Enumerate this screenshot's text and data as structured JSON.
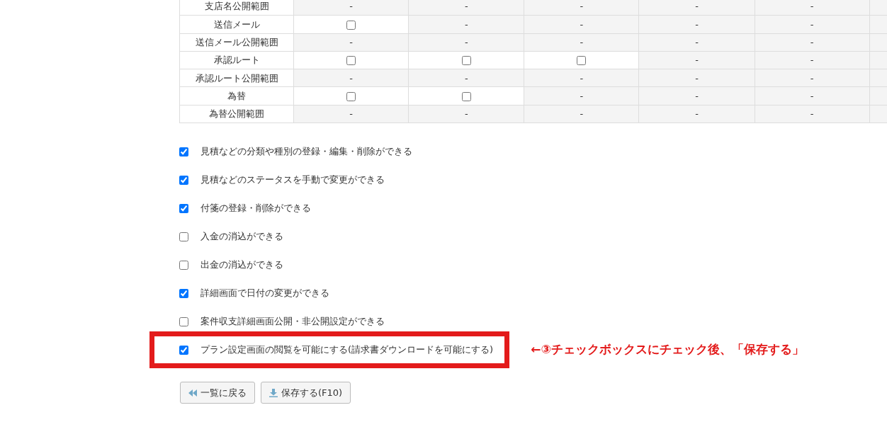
{
  "table": {
    "rows": [
      {
        "label": "支店名公開範囲",
        "cells": [
          {
            "kind": "dash",
            "text": "-"
          },
          {
            "kind": "dash",
            "text": "-"
          },
          {
            "kind": "dash",
            "text": "-"
          },
          {
            "kind": "dash",
            "text": "-"
          },
          {
            "kind": "dash",
            "text": "-"
          },
          {
            "kind": "blank"
          }
        ]
      },
      {
        "label": "送信メール",
        "cells": [
          {
            "kind": "checkbox",
            "checked": false
          },
          {
            "kind": "dash",
            "text": "-"
          },
          {
            "kind": "dash",
            "text": "-"
          },
          {
            "kind": "dash",
            "text": "-"
          },
          {
            "kind": "dash",
            "text": "-"
          },
          {
            "kind": "blank"
          }
        ]
      },
      {
        "label": "送信メール公開範囲",
        "cells": [
          {
            "kind": "dash",
            "text": "-"
          },
          {
            "kind": "dash",
            "text": "-"
          },
          {
            "kind": "dash",
            "text": "-"
          },
          {
            "kind": "dash",
            "text": "-"
          },
          {
            "kind": "dash",
            "text": "-"
          },
          {
            "kind": "blank"
          }
        ]
      },
      {
        "label": "承認ルート",
        "cells": [
          {
            "kind": "checkbox",
            "checked": false
          },
          {
            "kind": "checkbox",
            "checked": false
          },
          {
            "kind": "checkbox",
            "checked": false
          },
          {
            "kind": "dash",
            "text": "-"
          },
          {
            "kind": "dash",
            "text": "-"
          },
          {
            "kind": "blank"
          }
        ]
      },
      {
        "label": "承認ルート公開範囲",
        "cells": [
          {
            "kind": "dash",
            "text": "-"
          },
          {
            "kind": "dash",
            "text": "-"
          },
          {
            "kind": "dash",
            "text": "-"
          },
          {
            "kind": "dash",
            "text": "-"
          },
          {
            "kind": "dash",
            "text": "-"
          },
          {
            "kind": "blank"
          }
        ]
      },
      {
        "label": "為替",
        "cells": [
          {
            "kind": "checkbox",
            "checked": false
          },
          {
            "kind": "checkbox",
            "checked": false
          },
          {
            "kind": "dash",
            "text": "-"
          },
          {
            "kind": "dash",
            "text": "-"
          },
          {
            "kind": "dash",
            "text": "-"
          },
          {
            "kind": "blank"
          }
        ]
      },
      {
        "label": "為替公開範囲",
        "cells": [
          {
            "kind": "dash",
            "text": "-"
          },
          {
            "kind": "dash",
            "text": "-"
          },
          {
            "kind": "dash",
            "text": "-"
          },
          {
            "kind": "dash",
            "text": "-"
          },
          {
            "kind": "dash",
            "text": "-"
          },
          {
            "kind": "blank"
          }
        ]
      }
    ]
  },
  "permissions": [
    {
      "label": "見積などの分類や種別の登録・編集・削除ができる",
      "checked": true,
      "highlighted": false
    },
    {
      "label": "見積などのステータスを手動で変更ができる",
      "checked": true,
      "highlighted": false
    },
    {
      "label": "付箋の登録・削除ができる",
      "checked": true,
      "highlighted": false
    },
    {
      "label": "入金の消込ができる",
      "checked": false,
      "highlighted": false
    },
    {
      "label": "出金の消込ができる",
      "checked": false,
      "highlighted": false
    },
    {
      "label": "詳細画面で日付の変更ができる",
      "checked": true,
      "highlighted": false
    },
    {
      "label": "案件収支詳細画面公開・非公開設定ができる",
      "checked": false,
      "highlighted": false
    },
    {
      "label": "プラン設定画面の閲覧を可能にする(請求書ダウンロードを可能にする)",
      "checked": true,
      "highlighted": true,
      "annotation": "←③チェックボックスにチェック後、「保存する」"
    }
  ],
  "buttons": [
    {
      "kind": "back",
      "label": "一覧に戻る"
    },
    {
      "kind": "save",
      "label": "保存する(F10)"
    }
  ]
}
